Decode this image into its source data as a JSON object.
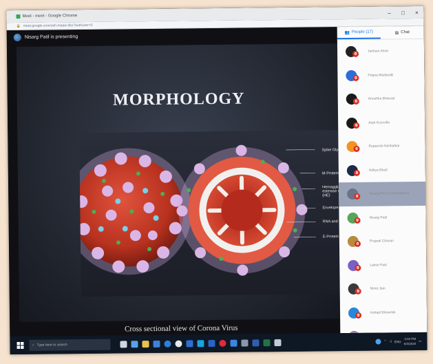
{
  "window": {
    "tab_title": "Meet - meet - Google Chrome",
    "url": "meet.google.com/ueh-maaw-dkx?authuser=0"
  },
  "presenter": {
    "text": "Nisarg Patil is presenting"
  },
  "slide": {
    "title": "MORPHOLOGY",
    "caption": "Cross sectional view of Corona Virus",
    "labels": [
      "Spike Glycoprotein",
      "M-Protein",
      "Hemagglutinin-esterase dimer (HE)",
      "Envelope",
      "RNA and N protein",
      "E-Protein"
    ]
  },
  "sidebar": {
    "tabs": [
      {
        "label": "People (17)"
      },
      {
        "label": "Chat"
      }
    ],
    "people": [
      {
        "name": "Janhavi Ahire",
        "color": "#222222"
      },
      {
        "name": "Prajna Madavalli",
        "color": "#2f6dd8"
      },
      {
        "name": "Anushka Bhavsar",
        "color": "#1a1a1a"
      },
      {
        "name": "Arpit Kuruvilla",
        "color": "#1a1a1a"
      },
      {
        "name": "Rupanshi Nimbalkar",
        "color": "#f39322"
      },
      {
        "name": "Aditya Bhatt",
        "color": "#1d2b4a"
      },
      {
        "name": "Nisarg Patil (Presentation)",
        "color": "#6b7388"
      },
      {
        "name": "Nisarg Patil",
        "color": "#58a65c"
      },
      {
        "name": "Prajwal Chavan",
        "color": "#b88a3c"
      },
      {
        "name": "Laksh Patil",
        "color": "#7a5fc6"
      },
      {
        "name": "Nimit Jain",
        "color": "#3a3a3a"
      },
      {
        "name": "Indrajit Bhowmik",
        "color": "#2a87d8"
      },
      {
        "name": "Vaibhavi Joshi",
        "color": "#9b84a6"
      }
    ]
  },
  "taskbar": {
    "search_placeholder": "Type here to search",
    "time": "4:03 PM",
    "date": "6/3/2020",
    "lang": "ENG"
  }
}
